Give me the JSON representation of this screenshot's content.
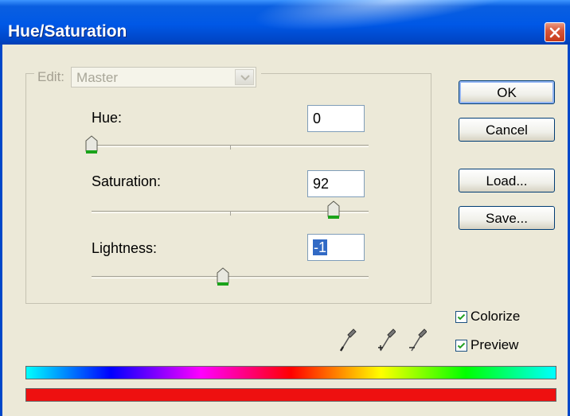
{
  "window": {
    "title": "Hue/Saturation"
  },
  "edit": {
    "label": "Edit:",
    "value": "Master"
  },
  "hue": {
    "label": "Hue:",
    "value": "0",
    "slider_fraction": 0.0
  },
  "saturation": {
    "label": "Saturation:",
    "value": "92",
    "slider_fraction": 0.92
  },
  "lightness": {
    "label": "Lightness:",
    "value": "-1",
    "slider_fraction": 0.5
  },
  "buttons": {
    "ok": "OK",
    "cancel": "Cancel",
    "load": "Load...",
    "save": "Save..."
  },
  "options": {
    "colorize": {
      "label": "Colorize",
      "checked": true
    },
    "preview": {
      "label": "Preview",
      "checked": true
    }
  },
  "icons": [
    "eyedropper-icon",
    "eyedropper-plus-icon",
    "eyedropper-minus-icon",
    "close-icon",
    "chevron-down-icon",
    "slider-thumb-icon"
  ],
  "colors": {
    "titlebar": "#0058e6",
    "spectrum_result": "#ee1010",
    "selection": "#316ac5"
  }
}
